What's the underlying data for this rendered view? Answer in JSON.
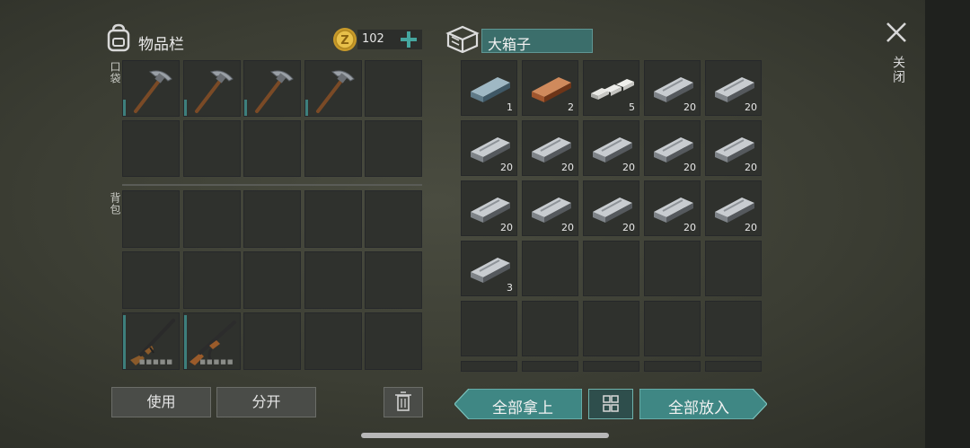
{
  "inventory": {
    "title": "物品栏",
    "coins": "102",
    "pocket_label": "口袋",
    "backpack_label": "背包",
    "pocket_items": [
      {
        "icon": "pickaxe-icon"
      },
      {
        "icon": "pickaxe-icon"
      },
      {
        "icon": "pickaxe-icon"
      },
      {
        "icon": "pickaxe-icon"
      },
      {
        "icon": ""
      },
      {
        "icon": ""
      },
      {
        "icon": ""
      },
      {
        "icon": ""
      },
      {
        "icon": ""
      },
      {
        "icon": ""
      }
    ],
    "backpack_items": [
      {
        "icon": ""
      },
      {
        "icon": ""
      },
      {
        "icon": ""
      },
      {
        "icon": ""
      },
      {
        "icon": ""
      },
      {
        "icon": ""
      },
      {
        "icon": ""
      },
      {
        "icon": ""
      },
      {
        "icon": ""
      },
      {
        "icon": ""
      },
      {
        "icon": "shotgun-icon"
      },
      {
        "icon": "ak-rifle-icon"
      },
      {
        "icon": ""
      },
      {
        "icon": ""
      },
      {
        "icon": ""
      }
    ],
    "use_label": "使用",
    "split_label": "分开"
  },
  "container": {
    "title": "大箱子",
    "items": [
      {
        "icon": "steel-bar-icon",
        "count": "1"
      },
      {
        "icon": "copper-bar-icon",
        "count": "2"
      },
      {
        "icon": "silver-bars-icon",
        "count": "5"
      },
      {
        "icon": "iron-bar-icon",
        "count": "20"
      },
      {
        "icon": "iron-bar-icon",
        "count": "20"
      },
      {
        "icon": "iron-bar-icon",
        "count": "20"
      },
      {
        "icon": "iron-bar-icon",
        "count": "20"
      },
      {
        "icon": "iron-bar-icon",
        "count": "20"
      },
      {
        "icon": "iron-bar-icon",
        "count": "20"
      },
      {
        "icon": "iron-bar-icon",
        "count": "20"
      },
      {
        "icon": "iron-bar-icon",
        "count": "20"
      },
      {
        "icon": "iron-bar-icon",
        "count": "20"
      },
      {
        "icon": "iron-bar-icon",
        "count": "20"
      },
      {
        "icon": "iron-bar-icon",
        "count": "20"
      },
      {
        "icon": "iron-bar-icon",
        "count": "20"
      },
      {
        "icon": "iron-bar-icon",
        "count": "3"
      }
    ],
    "take_all_label": "全部拿上",
    "put_all_label": "全部放入"
  },
  "close_label": "关闭",
  "colors": {
    "accent": "#3d7f7c",
    "panel": "#2f312d",
    "button_teal": "#3f8784"
  }
}
